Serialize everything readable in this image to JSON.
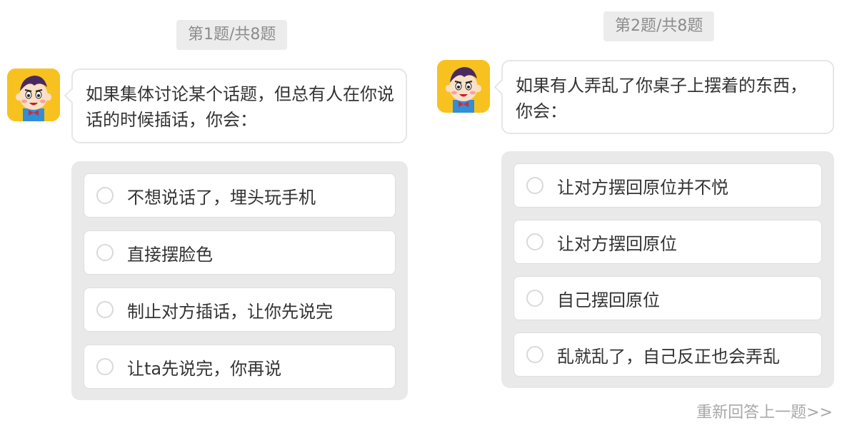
{
  "question1": {
    "counter": "第1题/共8题",
    "prompt": "如果集体讨论某个话题，但总有人在你说话的时候插话，你会：",
    "options": [
      {
        "label": "不想说话了，埋头玩手机"
      },
      {
        "label": "直接摆脸色"
      },
      {
        "label": "制止对方插话，让你先说完"
      },
      {
        "label": "让ta先说完，你再说"
      }
    ]
  },
  "question2": {
    "counter": "第2题/共8题",
    "prompt": "如果有人弄乱了你桌子上摆着的东西，你会：",
    "options": [
      {
        "label": "让对方摆回原位并不悦"
      },
      {
        "label": "让对方摆回原位"
      },
      {
        "label": "自己摆回原位"
      },
      {
        "label": "乱就乱了，自己反正也会弄乱"
      }
    ],
    "retry_link": "重新回答上一题>>"
  },
  "colors": {
    "avatar_bg": "#f7c21f",
    "options_bg": "#e9e9e9",
    "counter_bg": "#ececec",
    "muted_text": "#a8a8a8"
  },
  "icons": {
    "avatar": "cartoon-boy-avatar-icon",
    "radio": "radio-unchecked-icon"
  }
}
